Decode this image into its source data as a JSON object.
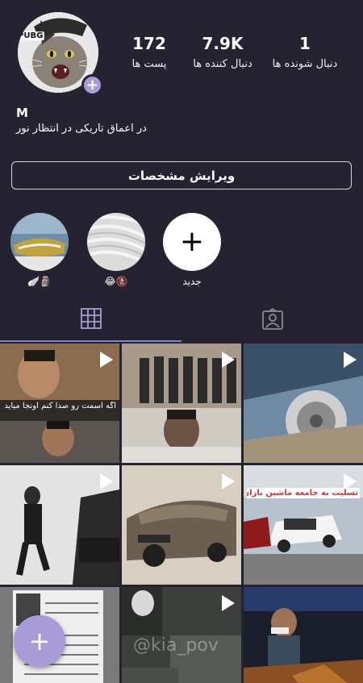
{
  "profile": {
    "avatar_brand": "PUBG",
    "username": "M",
    "bio": "در اعماق تاریکی در انتظار نور",
    "edit_button": "ویرایش مشخصات"
  },
  "stats": [
    {
      "value": "172",
      "label": "پست ها"
    },
    {
      "value": "7.9K",
      "label": "دنبال کننده ها"
    },
    {
      "value": "1",
      "label": "دنبال شونده ها"
    }
  ],
  "highlights": [
    {
      "caption": "🪽🗿"
    },
    {
      "caption": "😂🚷"
    },
    {
      "caption": "جدید",
      "icon": "plus-icon"
    }
  ],
  "tabs": [
    {
      "icon": "grid-icon",
      "active": true
    },
    {
      "icon": "tagged-person-icon",
      "active": false
    }
  ],
  "posts": [
    {
      "caption": "اگه اسمت رو صدا کنم اونجا میاید 😂😂",
      "video": true
    },
    {
      "caption": "",
      "video": true
    },
    {
      "caption": "",
      "video": true
    },
    {
      "caption": "",
      "video": true
    },
    {
      "caption": "",
      "video": true
    },
    {
      "caption": "تسلیت به جامعه ماشین بازان ایران",
      "video": true
    },
    {
      "caption": "",
      "video": false
    },
    {
      "caption": "@kia_pov",
      "video": true
    },
    {
      "caption": "",
      "video": false
    }
  ],
  "colors": {
    "background": "#252331",
    "accent": "#a89bd8",
    "active_tab": "#8a82c8"
  }
}
